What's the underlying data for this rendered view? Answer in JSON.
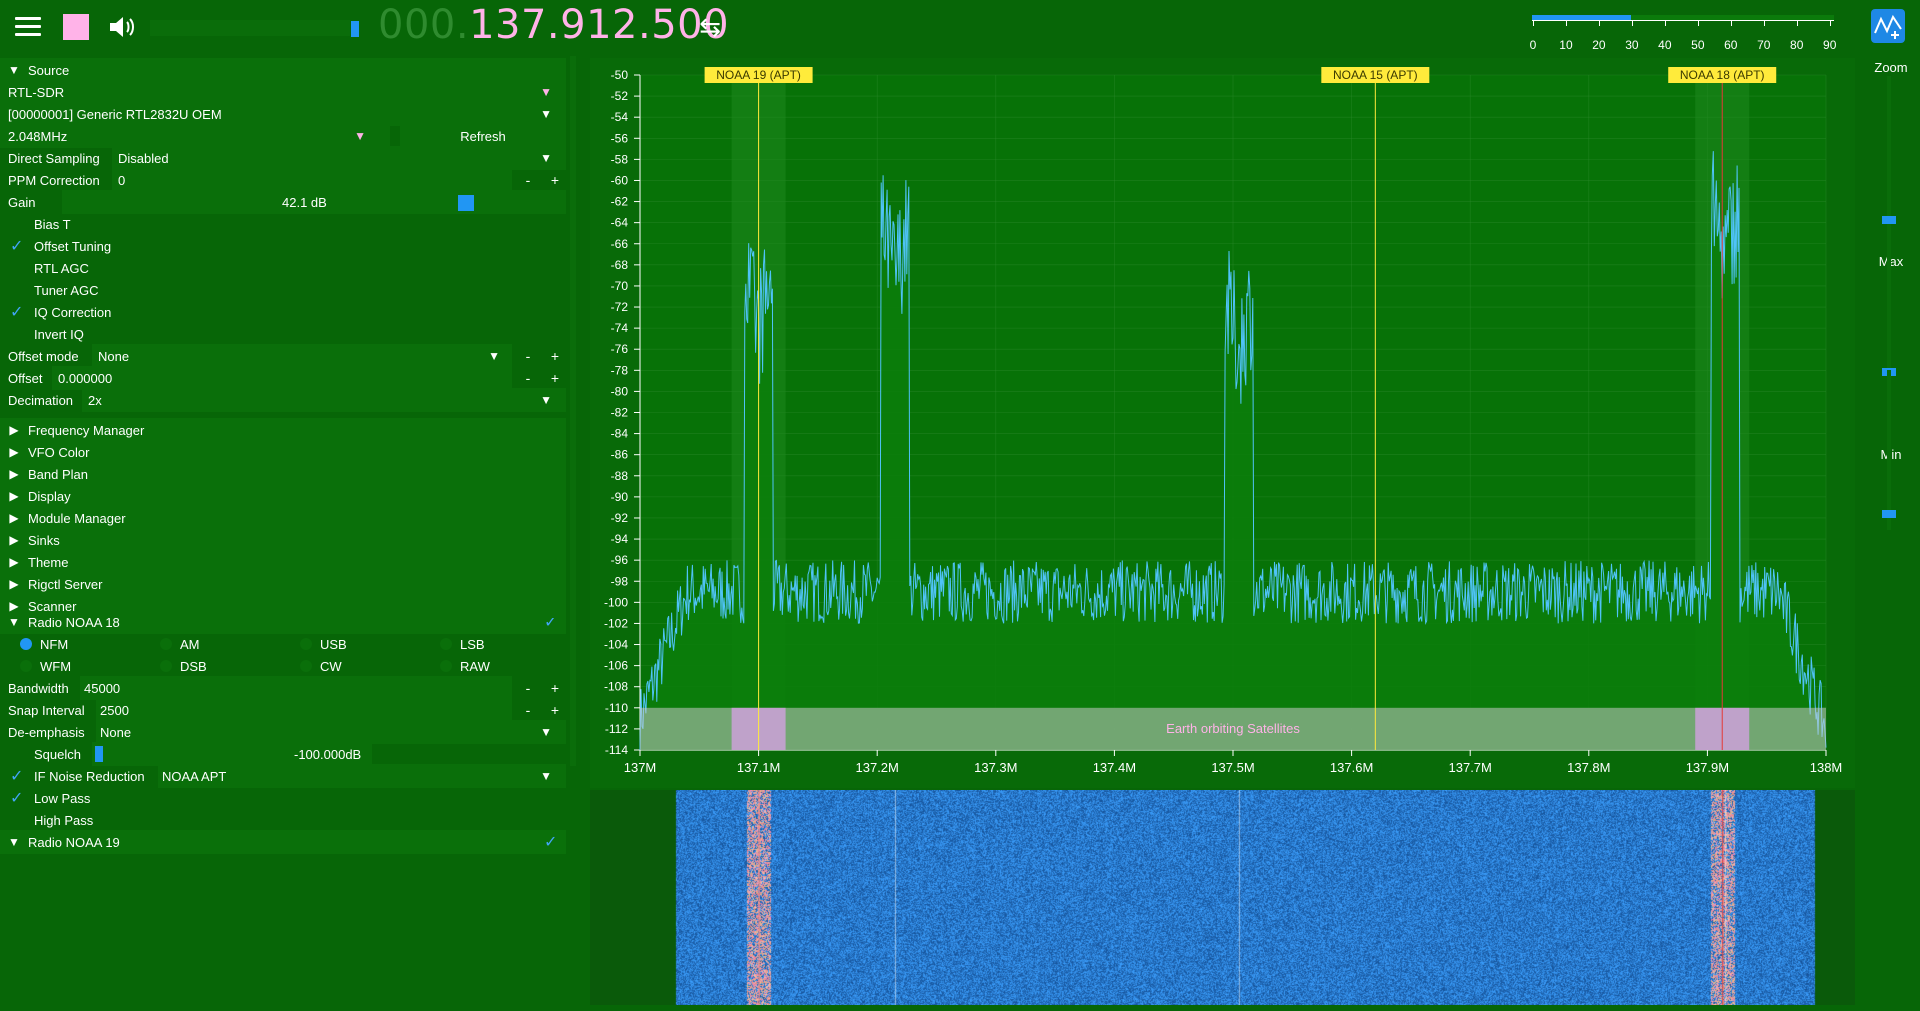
{
  "topbar": {
    "freq_dim": "000.",
    "freq_lit": "137.912.500",
    "snr_ticks": [
      "0",
      "10",
      "20",
      "30",
      "40",
      "50",
      "60",
      "70",
      "80",
      "90"
    ],
    "snr_level": 0.33
  },
  "source": {
    "header": "Source",
    "device_type": "RTL-SDR",
    "device": "[00000001] Generic RTL2832U OEM",
    "samplerate": "2.048MHz",
    "refresh": "Refresh",
    "direct_sampling_label": "Direct Sampling",
    "direct_sampling_value": "Disabled",
    "ppm_label": "PPM Correction",
    "ppm_value": "0",
    "gain_label": "Gain",
    "gain_value": "42.1 dB",
    "bias_t": "Bias T",
    "offset_tuning": "Offset Tuning",
    "rtl_agc": "RTL AGC",
    "tuner_agc": "Tuner AGC",
    "iq_correction": "IQ Correction",
    "invert_iq": "Invert IQ",
    "offset_mode_label": "Offset mode",
    "offset_mode_value": "None",
    "offset_label": "Offset",
    "offset_value": "0.000000",
    "decimation_label": "Decimation",
    "decimation_value": "2x"
  },
  "menus": [
    "Frequency Manager",
    "VFO Color",
    "Band Plan",
    "Display",
    "Module Manager",
    "Sinks",
    "Theme",
    "Rigctl Server",
    "Scanner"
  ],
  "radio18": {
    "header": "Radio NOAA 18",
    "modes_row1": [
      "NFM",
      "AM",
      "USB",
      "LSB"
    ],
    "modes_row2": [
      "WFM",
      "DSB",
      "CW",
      "RAW"
    ],
    "bandwidth_label": "Bandwidth",
    "bandwidth_value": "45000",
    "snap_label": "Snap Interval",
    "snap_value": "2500",
    "deemph_label": "De-emphasis",
    "deemph_value": "None",
    "squelch_label": "Squelch",
    "squelch_value": "-100.000dB",
    "ifnr_label": "IF Noise Reduction",
    "ifnr_value": "NOAA APT",
    "low_pass": "Low Pass",
    "high_pass": "High Pass"
  },
  "radio19": {
    "header": "Radio NOAA 19"
  },
  "right": {
    "zoom": "Zoom",
    "max": "Max",
    "min": "Min"
  },
  "colors": {
    "background": "#076607",
    "accent": "#2196f3",
    "vfo_label_bg": "#ffeb3b",
    "pink": "#ffb3e8"
  },
  "chart_data": {
    "type": "line",
    "x_ticks": [
      "137M",
      "137.1M",
      "137.2M",
      "137.3M",
      "137.4M",
      "137.5M",
      "137.6M",
      "137.7M",
      "137.8M",
      "137.9M",
      "138M"
    ],
    "y_ticks": [
      "-50",
      "-52",
      "-54",
      "-56",
      "-58",
      "-60",
      "-62",
      "-64",
      "-66",
      "-68",
      "-70",
      "-72",
      "-74",
      "-76",
      "-78",
      "-80",
      "-82",
      "-84",
      "-86",
      "-88",
      "-90",
      "-92",
      "-94",
      "-96",
      "-98",
      "-100",
      "-102",
      "-104",
      "-106",
      "-108",
      "-110",
      "-112",
      "-114"
    ],
    "xlim": [
      137.0,
      138.0
    ],
    "ylim": [
      -114,
      -50
    ],
    "noise_floor": -99,
    "peaks": [
      {
        "x": 137.1,
        "y": -80
      },
      {
        "x": 137.215,
        "y": -75
      },
      {
        "x": 137.505,
        "y": -82
      },
      {
        "x": 137.915,
        "y": -73
      }
    ],
    "vfos": [
      {
        "name": "NOAA 19 (APT)",
        "x": 137.1
      },
      {
        "name": "NOAA 15 (APT)",
        "x": 137.62
      },
      {
        "name": "NOAA 18 (APT)",
        "x": 137.9125
      }
    ],
    "band": {
      "label": "Earth orbiting Satellites",
      "from": 137.0,
      "to": 138.0
    }
  }
}
